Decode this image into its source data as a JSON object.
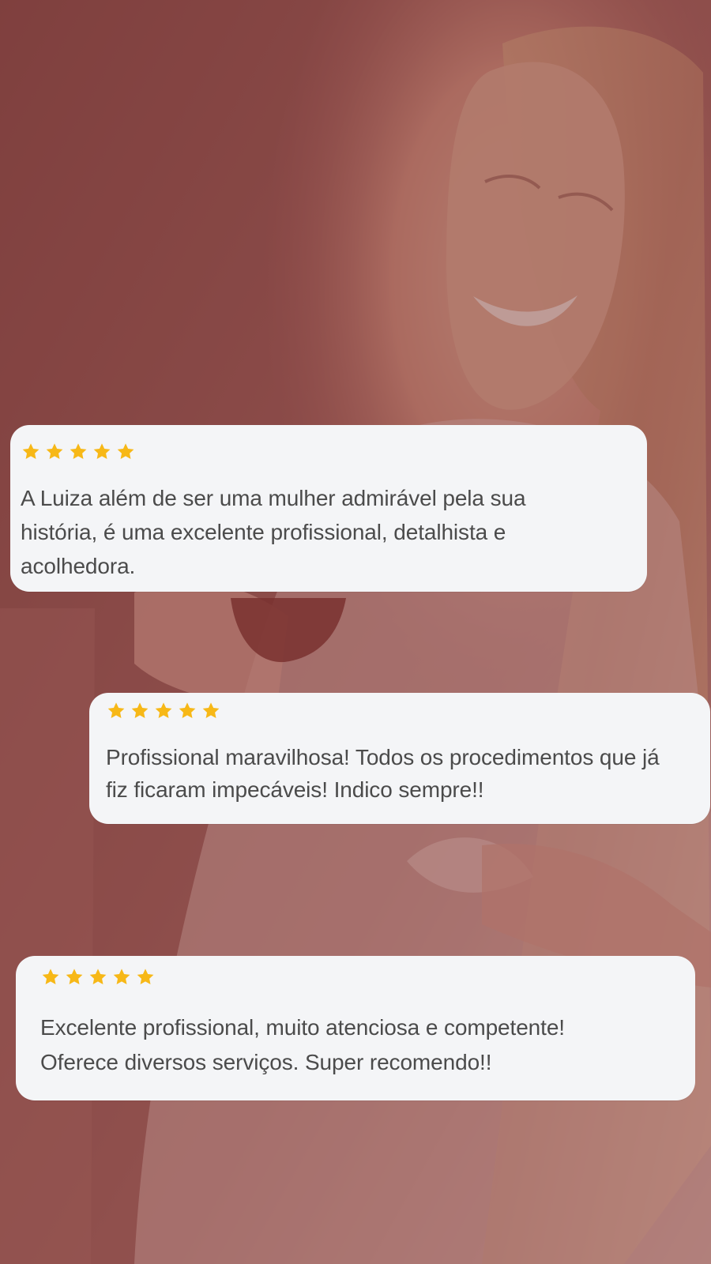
{
  "background": {
    "overlay_color": "#7a3634",
    "scene": "smiling woman holding tea cup"
  },
  "icons": {
    "star": "star-icon"
  },
  "colors": {
    "card_background": "#f4f5f7",
    "star": "#f7b817",
    "text": "#4b4b4b"
  },
  "reviews": [
    {
      "rating": 5,
      "text": "A Luiza além de ser uma mulher admirável pela sua\nhistória, é uma excelente profissional, detalhista e\nacolhedora."
    },
    {
      "rating": 5,
      "text": "Profissional maravilhosa! Todos os procedimentos que já\nfiz ficaram impecáveis! Indico sempre!!"
    },
    {
      "rating": 5,
      "text": "Excelente profissional, muito atenciosa e competente!\nOferece diversos serviços. Super recomendo!!"
    }
  ]
}
